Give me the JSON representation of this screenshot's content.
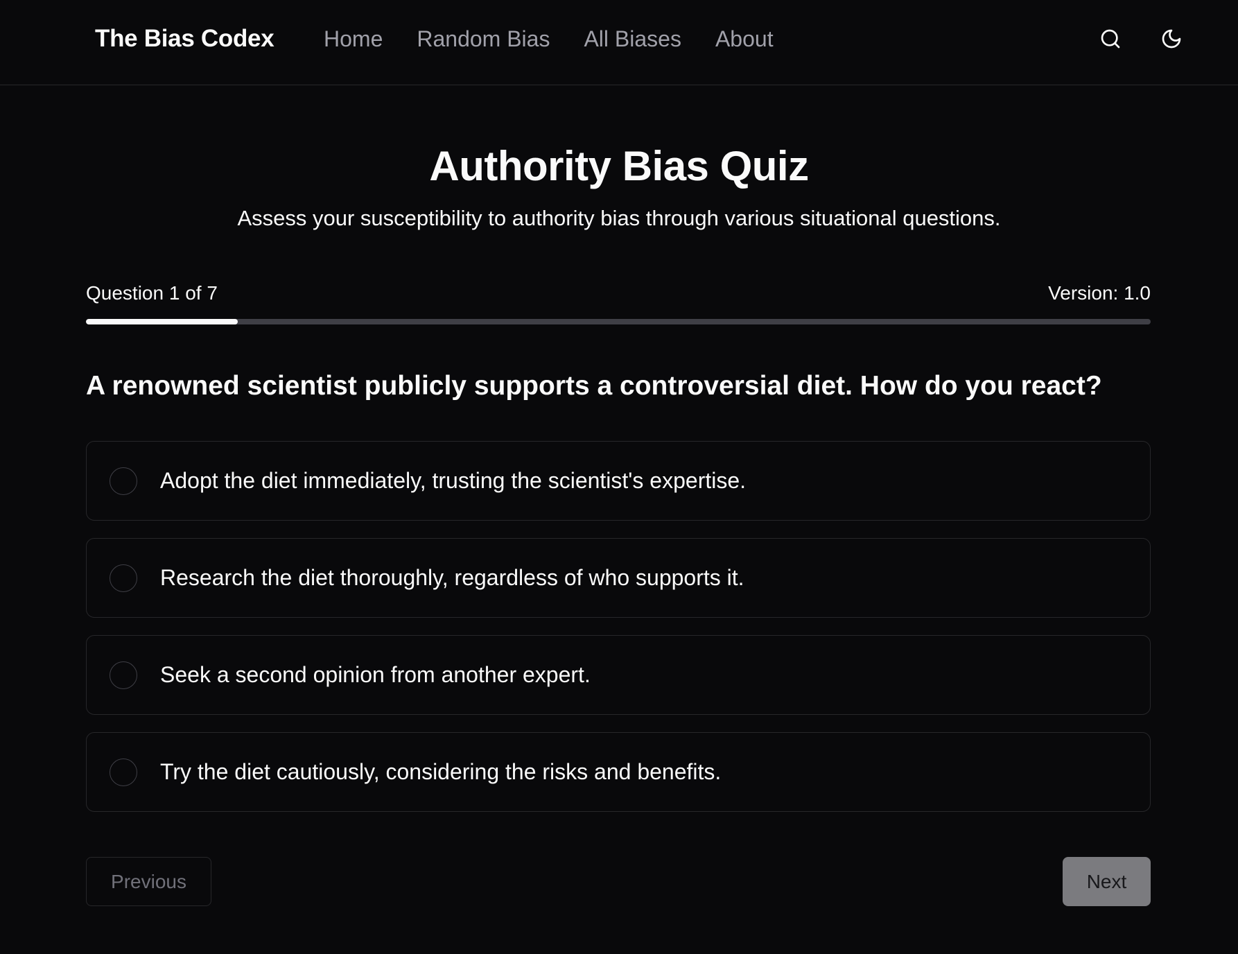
{
  "nav": {
    "brand": "The Bias Codex",
    "links": [
      "Home",
      "Random Bias",
      "All Biases",
      "About"
    ],
    "icons": [
      "search-icon",
      "moon-icon"
    ]
  },
  "header": {
    "title": "Authority Bias Quiz",
    "subtitle": "Assess your susceptibility to authority bias through various situational questions."
  },
  "progress": {
    "question_label": "Question 1 of 7",
    "version_label": "Version: 1.0",
    "fraction": 0.1429
  },
  "question": {
    "text": "A renowned scientist publicly supports a controversial diet. How do you react?",
    "options": [
      "Adopt the diet immediately, trusting the scientist's expertise.",
      "Research the diet thoroughly, regardless of who supports it.",
      "Seek a second opinion from another expert.",
      "Try the diet cautiously, considering the risks and benefits."
    ]
  },
  "buttons": {
    "previous": "Previous",
    "next": "Next"
  },
  "colors": {
    "background": "#09090b",
    "border": "#27272a",
    "progress_fill": "#fafafa",
    "progress_track": "#3f3f46",
    "next_button": "#7b7b7f"
  }
}
